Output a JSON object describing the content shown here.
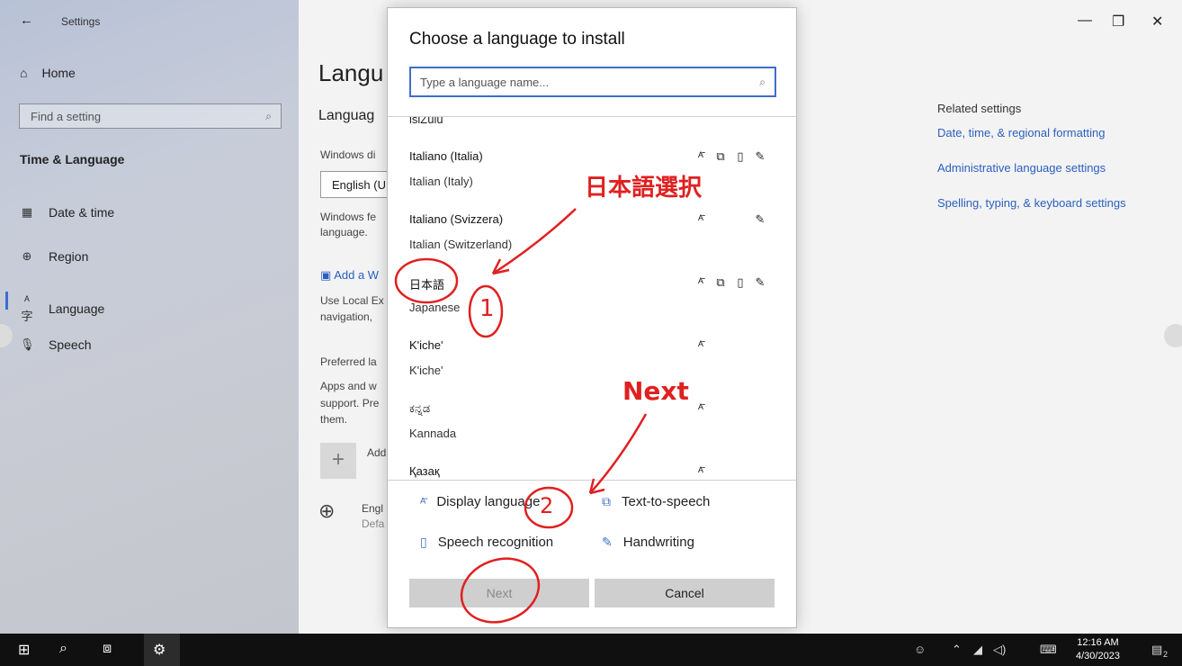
{
  "sidebar": {
    "back_glyph": "←",
    "title": "Settings",
    "home_label": "Home",
    "search_placeholder": "Find a setting",
    "section": "Time & Language",
    "items": [
      {
        "label": "Date & time",
        "icon": "calendar-clock-icon"
      },
      {
        "label": "Region",
        "icon": "globe-icon"
      },
      {
        "label": "Language",
        "icon": "language-icon"
      },
      {
        "label": "Speech",
        "icon": "microphone-icon"
      }
    ]
  },
  "main": {
    "title": "Langu",
    "subtitle": "Languag",
    "windows_display_text": "Windows di",
    "display_select": "English (U",
    "windows_features_text": "Windows fe",
    "language_text": "language.",
    "add_link": "Add a W",
    "local_exp_text": "Use Local Ex",
    "navigation_text": "navigation,",
    "preferred_text": "Preferred la",
    "apps_text": "Apps and w",
    "support_text": "support. Pre",
    "them_text": "them.",
    "add_label": "Add",
    "lang_item_a": "Engl",
    "lang_item_b": "Defa"
  },
  "related": {
    "heading": "Related settings",
    "links": [
      "Date, time, & regional formatting",
      "Administrative language settings",
      "Spelling, typing, & keyboard settings"
    ]
  },
  "dialog": {
    "title": "Choose a language to install",
    "search_placeholder": "Type a language name...",
    "partial_item": "isiZulu",
    "languages": [
      {
        "native": "Italiano (Italia)",
        "english": "Italian (Italy)",
        "features": [
          "display",
          "tts",
          "speech",
          "handwriting"
        ]
      },
      {
        "native": "Italiano (Svizzera)",
        "english": "Italian (Switzerland)",
        "features": [
          "display",
          "handwriting"
        ]
      },
      {
        "native": "日本語",
        "english": "Japanese",
        "features": [
          "display",
          "tts",
          "speech",
          "handwriting"
        ]
      },
      {
        "native": "K'iche'",
        "english": "K'iche'",
        "features": [
          "display"
        ]
      },
      {
        "native": "ಕನ್ನಡ",
        "english": "Kannada",
        "features": [
          "display"
        ]
      },
      {
        "native": "Қазақ",
        "english": "",
        "features": [
          "display"
        ]
      }
    ],
    "legend": {
      "display": "Display language",
      "tts": "Text-to-speech",
      "speech": "Speech recognition",
      "handwriting": "Handwriting"
    },
    "next_label": "Next",
    "cancel_label": "Cancel"
  },
  "annotations": {
    "select_japanese": "日本語選択",
    "next": "Next",
    "step1": "1",
    "step2": "2"
  },
  "taskbar": {
    "time": "12:16 AM",
    "date": "4/30/2023",
    "notification_count": "2"
  }
}
